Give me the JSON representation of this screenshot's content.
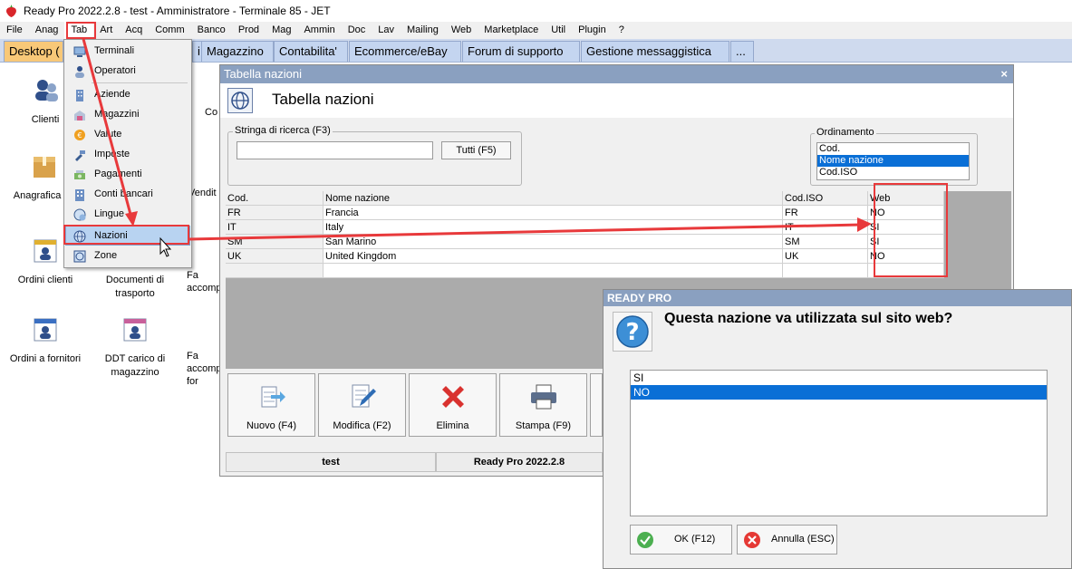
{
  "window": {
    "title": "Ready Pro 2022.2.8 - test - Amministratore - Terminale 85 - JET"
  },
  "menubar": [
    "File",
    "Anag",
    "Tab",
    "Art",
    "Acq",
    "Comm",
    "Banco",
    "Prod",
    "Mag",
    "Ammin",
    "Doc",
    "Lav",
    "Mailing",
    "Web",
    "Marketplace",
    "Util",
    "Plugin",
    "?"
  ],
  "tabs": [
    "Desktop (",
    "Magazzino",
    "Contabilita'",
    "Ecommerce/eBay",
    "Forum di supporto",
    "Gestione messaggistica",
    "..."
  ],
  "desktop": {
    "icons": [
      {
        "label": "Clienti"
      },
      {
        "label": "Anagrafica art"
      },
      {
        "label": "Ordini clienti"
      },
      {
        "label": "Documenti di trasporto"
      },
      {
        "label": "Ordini a fornitori"
      },
      {
        "label": "DDT carico di magazzino"
      }
    ],
    "partial": [
      "Co",
      "Vendit",
      "Fa accomp",
      "Fa accomp for"
    ]
  },
  "tab_menu": {
    "items": [
      "Terminali",
      "Operatori",
      "Aziende",
      "Magazzini",
      "Valute",
      "Imposte",
      "Pagamenti",
      "Conti bancari",
      "Lingue",
      "Nazioni",
      "Zone"
    ],
    "selected": "Nazioni"
  },
  "tabella": {
    "window_title": "Tabella nazioni",
    "heading": "Tabella nazioni",
    "search_label": "Stringa di ricerca (F3)",
    "search_value": "",
    "tutti_button": "Tutti (F5)",
    "ordinamento_label": "Ordinamento",
    "ordinamento_options": [
      "Cod.",
      "Nome nazione",
      "Cod.ISO"
    ],
    "ordinamento_selected": "Nome nazione",
    "columns": [
      "Cod.",
      "Nome nazione",
      "Cod.ISO",
      "Web"
    ],
    "rows": [
      [
        "FR",
        "Francia",
        "FR",
        "NO"
      ],
      [
        "IT",
        "Italy",
        "IT",
        "SI"
      ],
      [
        "SM",
        "San Marino",
        "SM",
        "SI"
      ],
      [
        "UK",
        "United Kingdom",
        "UK",
        "NO"
      ]
    ],
    "buttons": [
      "Nuovo (F4)",
      "Modifica (F2)",
      "Elimina",
      "Stampa (F9)"
    ],
    "status": [
      "test",
      "Ready Pro 2022.2.8"
    ]
  },
  "dialog": {
    "title": "READY PRO",
    "question": "Questa nazione va utilizzata sul sito web?",
    "options": [
      "SI",
      "NO"
    ],
    "selected": "NO",
    "ok_button": "OK (F12)",
    "cancel_button": "Annulla (ESC)"
  },
  "colors": {
    "accent": "#e8393b",
    "selection": "#0a6fd6",
    "title": "#8aa0c0"
  }
}
